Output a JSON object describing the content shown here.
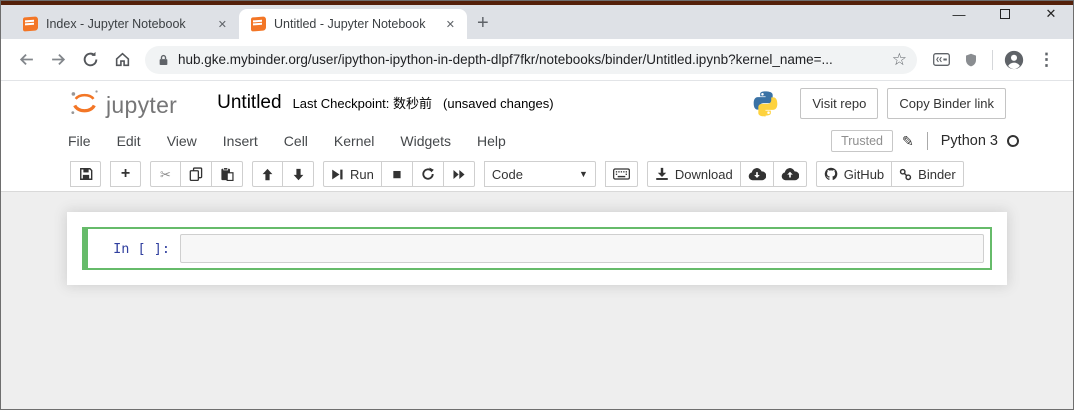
{
  "browser": {
    "tabs": [
      {
        "title": "Index - Jupyter Notebook"
      },
      {
        "title": "Untitled - Jupyter Notebook"
      }
    ],
    "new_tab_glyph": "+",
    "tab_close_glyph": "✕",
    "url": "hub.gke.mybinder.org/user/ipython-ipython-in-depth-dlpf7fkr/notebooks/binder/Untitled.ipynb?kernel_name=...",
    "window_controls": {
      "minimize": "—",
      "close": "✕"
    },
    "star_glyph": "☆",
    "kebab_glyph": "⋮"
  },
  "jupyter": {
    "logo_text": "jupyter",
    "title": "Untitled",
    "checkpoint": "Last Checkpoint: 数秒前",
    "unsaved": "(unsaved changes)",
    "visit_repo_label": "Visit repo",
    "copy_binder_label": "Copy Binder link",
    "menu_items": [
      "File",
      "Edit",
      "View",
      "Insert",
      "Cell",
      "Kernel",
      "Widgets",
      "Help"
    ],
    "trusted_label": "Trusted",
    "pencil_glyph": "✎",
    "kernel_name": "Python 3",
    "toolbar": {
      "plus_glyph": "+",
      "cut_glyph": "✂",
      "run_label": "Run",
      "stop_glyph": "■",
      "cell_type_selected": "Code",
      "caret_glyph": "▼",
      "download_label": "Download",
      "github_label": "GitHub",
      "binder_label": "Binder"
    },
    "cell_prompt": "In [ ]:"
  },
  "colors": {
    "jupyter_orange": "#F37626",
    "edit_mode_green": "#66BB6A",
    "prompt_blue": "#303F9F",
    "page_bg": "#EEEEEE",
    "tabstrip_bg": "#DEE1E6",
    "window_top_border": "#54200A"
  }
}
